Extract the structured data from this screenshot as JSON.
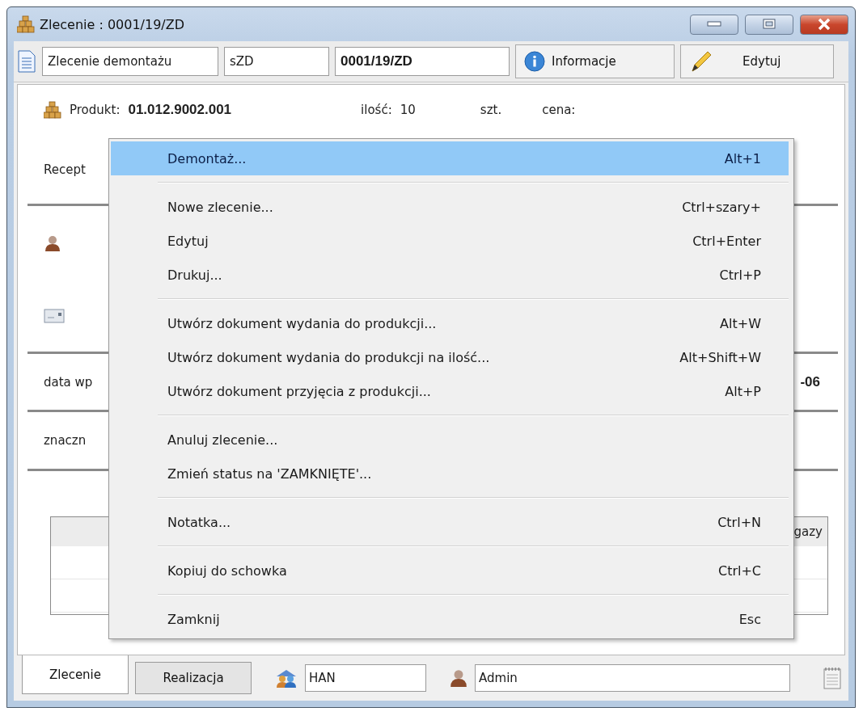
{
  "window": {
    "title": "Zlecenie : 0001/19/ZD"
  },
  "toolbar": {
    "document_type": "Zlecenie demontażu",
    "series": "sZD",
    "number": "0001/19/ZD",
    "buttons": [
      {
        "label": "Informacje",
        "kind": "info"
      },
      {
        "label": "Edytuj",
        "kind": "edit"
      }
    ]
  },
  "product": {
    "label": "Produkt:",
    "code": "01.012.9002.001",
    "quantity_label": "ilość:",
    "quantity": "10",
    "unit": "szt.",
    "price_label": "cena:"
  },
  "background_labels": {
    "recipe": "Recept",
    "date": "data wp",
    "date_value": "-06",
    "marking": "znaczn",
    "table_header": "gazy"
  },
  "context_menu": [
    {
      "kind": "item",
      "label": "Demontaż...",
      "shortcut": "Alt+1",
      "selected": true
    },
    {
      "kind": "separator"
    },
    {
      "kind": "item",
      "label": "Nowe zlecenie...",
      "shortcut": "Ctrl+szary+",
      "selected": false
    },
    {
      "kind": "item",
      "label": "Edytuj",
      "shortcut": "Ctrl+Enter",
      "selected": false
    },
    {
      "kind": "item",
      "label": "Drukuj...",
      "shortcut": "Ctrl+P",
      "selected": false
    },
    {
      "kind": "separator"
    },
    {
      "kind": "item",
      "label": "Utwórz dokument wydania do produkcji...",
      "shortcut": "Alt+W",
      "selected": false
    },
    {
      "kind": "item",
      "label": "Utwórz dokument wydania do produkcji na ilość...",
      "shortcut": "Alt+Shift+W",
      "selected": false
    },
    {
      "kind": "item",
      "label": "Utwórz dokument przyjęcia z produkcji...",
      "shortcut": "Alt+P",
      "selected": false
    },
    {
      "kind": "separator"
    },
    {
      "kind": "item",
      "label": "Anuluj zlecenie...",
      "selected": false
    },
    {
      "kind": "item",
      "label": "Zmień status na 'ZAMKNIĘTE'...",
      "selected": false
    },
    {
      "kind": "separator"
    },
    {
      "kind": "item",
      "label": "Notatka...",
      "shortcut": "Ctrl+N",
      "selected": false
    },
    {
      "kind": "separator"
    },
    {
      "kind": "item",
      "label": "Kopiuj do schowka",
      "shortcut": "Ctrl+C",
      "selected": false
    },
    {
      "kind": "separator"
    },
    {
      "kind": "item",
      "label": "Zamknij",
      "shortcut": "Esc",
      "selected": false
    }
  ],
  "bottom_tabs": [
    {
      "label": "Zlecenie",
      "selected": true
    },
    {
      "label": "Realizacja",
      "selected": false
    }
  ],
  "status_fields": [
    {
      "kind": "group",
      "value": "HAN"
    },
    {
      "kind": "user",
      "value": "Admin"
    }
  ]
}
